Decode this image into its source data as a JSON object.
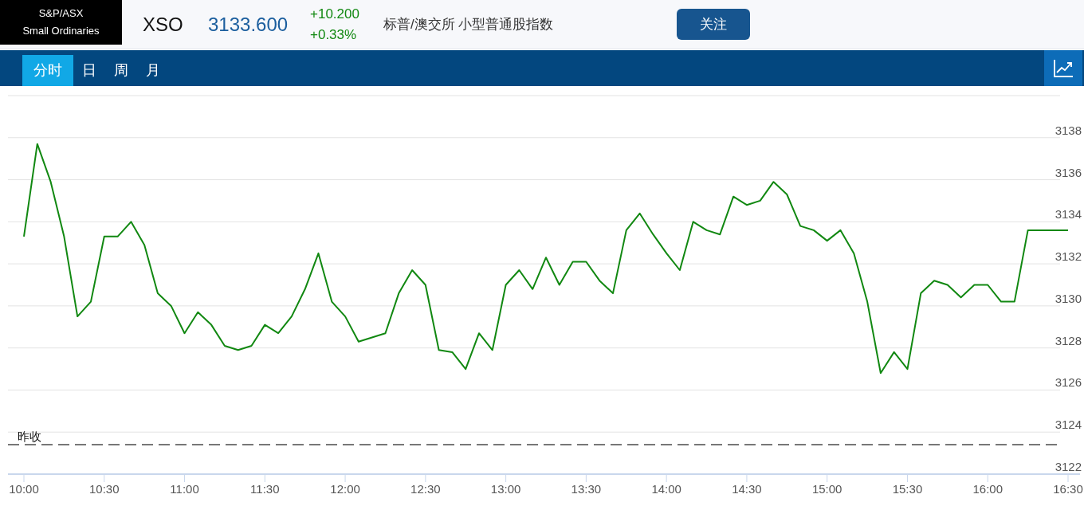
{
  "header": {
    "index_name": [
      "S&P/ASX",
      "Small Ordinaries"
    ],
    "symbol": "XSO",
    "price": "3133.600",
    "change": "+10.200",
    "change_percent": "+0.33%",
    "description": "标普/澳交所 小型普通股指数",
    "follow_button": "关注"
  },
  "tabs": [
    {
      "label": "分时",
      "selected": true
    },
    {
      "label": "日",
      "selected": false
    },
    {
      "label": "周",
      "selected": false
    },
    {
      "label": "月",
      "selected": false
    }
  ],
  "chart": {
    "chart_data": {
      "type": "line",
      "ylim": [
        3122,
        3140
      ],
      "yticks": [
        3122,
        3124,
        3126,
        3128,
        3130,
        3132,
        3134,
        3136,
        3138
      ],
      "categories": [
        "10:00",
        null,
        null,
        null,
        null,
        null,
        "10:30",
        null,
        null,
        null,
        null,
        null,
        "11:00",
        null,
        null,
        null,
        null,
        null,
        "11:30",
        null,
        null,
        null,
        null,
        null,
        "12:00",
        null,
        null,
        null,
        null,
        null,
        "12:30",
        null,
        null,
        null,
        null,
        null,
        "13:00",
        null,
        null,
        null,
        null,
        null,
        "13:30",
        null,
        null,
        null,
        null,
        null,
        "14:00",
        null,
        null,
        null,
        null,
        null,
        "14:30",
        null,
        null,
        null,
        null,
        null,
        "15:00",
        null,
        null,
        null,
        null,
        null,
        "15:30",
        null,
        null,
        null,
        null,
        null,
        "16:00",
        null,
        null,
        null,
        null,
        null,
        "16:30"
      ],
      "series": [
        {
          "color": "#118811",
          "values": [
            3133.3,
            3137.7,
            3135.9,
            3133.3,
            3129.5,
            3130.2,
            3133.3,
            3133.3,
            3134,
            3132.9,
            3130.6,
            3130,
            3128.7,
            3129.7,
            3129.1,
            3128.1,
            3127.9,
            3128.1,
            3129.1,
            3128.7,
            3129.5,
            3130.8,
            3132.5,
            3130.2,
            3129.5,
            3128.3,
            3128.5,
            3128.7,
            3130.6,
            3131.7,
            3131,
            3127.9,
            3127.8,
            3127,
            3128.7,
            3127.9,
            3131,
            3131.7,
            3130.8,
            3132.3,
            3131,
            3132.1,
            3132.1,
            3131.2,
            3130.6,
            3133.6,
            3134.4,
            3133.4,
            3132.5,
            3131.7,
            3134,
            3133.6,
            3133.4,
            3135.2,
            3134.8,
            3135,
            3135.9,
            3135.3,
            3133.8,
            3133.6,
            3133.1,
            3133.6,
            3132.5,
            3130.2,
            3126.8,
            3127.8,
            3127,
            3130.6,
            3131.2,
            3131,
            3130.4,
            3131,
            3131,
            3130.2,
            3130.2,
            3133.6,
            3133.6,
            3133.6,
            3133.6
          ]
        }
      ],
      "grid": true,
      "ref_lines": [
        {
          "axis": "y",
          "value": 3123.4,
          "label": "昨收"
        }
      ]
    }
  }
}
